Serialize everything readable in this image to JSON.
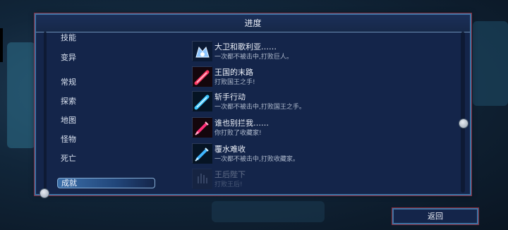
{
  "window": {
    "title": "进度"
  },
  "sidebar": {
    "items": [
      {
        "label": "技能"
      },
      {
        "label": "变异"
      },
      {
        "label": "常规"
      },
      {
        "label": "探索"
      },
      {
        "label": "地图"
      },
      {
        "label": "怪物"
      },
      {
        "label": "死亡"
      },
      {
        "label": "成就",
        "selected": true
      }
    ]
  },
  "achievements": [
    {
      "name": "大卫和歌利亚……",
      "desc": "一次都不被击中,打败巨人。",
      "icon": "giant-crown-icon",
      "locked": false
    },
    {
      "name": "王国的末路",
      "desc": "打败国王之手!",
      "icon": "red-sword-icon",
      "locked": false
    },
    {
      "name": "斩手行动",
      "desc": "一次都不被击中,打败国王之手。",
      "icon": "blue-sword-icon",
      "locked": false
    },
    {
      "name": "谁也别拦我……",
      "desc": "你打败了收藏家!",
      "icon": "red-syringe-icon",
      "locked": false
    },
    {
      "name": "覆水难收",
      "desc": "一次都不被击中,打败收藏家。",
      "icon": "blue-syringe-icon",
      "locked": false
    },
    {
      "name": "王后陛下",
      "desc": "打败王后!",
      "icon": "locked-achievement-icon",
      "locked": true
    }
  ],
  "footer": {
    "back_label": "返回"
  },
  "colors": {
    "panel": "#14254a",
    "border": "#3f73a3",
    "accent_red": "#8a2c3c"
  }
}
